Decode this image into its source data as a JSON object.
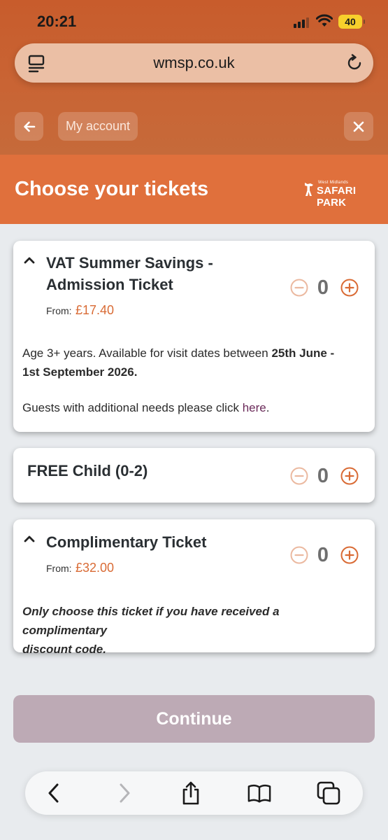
{
  "status_bar": {
    "time": "20:21",
    "battery": "40"
  },
  "browser": {
    "url": "wmsp.co.uk",
    "account_label": "My account"
  },
  "header": {
    "title": "Choose your tickets",
    "brand_small": "West Midlands",
    "brand_name": "SAFARI PARK"
  },
  "tickets": [
    {
      "name_line1": "VAT Summer Savings -",
      "name_line2": "Admission Ticket",
      "from_label": "From:",
      "price": "£17.40",
      "quantity": "0",
      "desc_1a": "Age 3+ years. Available for visit dates between ",
      "desc_1b": "25th June -",
      "desc_2": "1st September 2026.",
      "desc_3a": "Guests with additional needs please click ",
      "desc_3_link": "here",
      "desc_3b": "."
    },
    {
      "name": "FREE Child (0-2)",
      "quantity": "0"
    },
    {
      "name": "Complimentary Ticket",
      "from_label": "From:",
      "price": "£32.00",
      "quantity": "0",
      "desc_1": "Only choose this ticket if you have received a complimentary",
      "desc_2": "discount code."
    }
  ],
  "continue_label": "Continue",
  "colors": {
    "brand_orange": "#e0703c",
    "price_orange": "#d96b35",
    "continue_disabled": "#bdaab5"
  },
  "icons": {
    "url_bar": [
      "page-menu-icon",
      "reload-icon"
    ],
    "nav": [
      "back-arrow-icon",
      "close-icon"
    ],
    "toolbar": [
      "back-icon",
      "forward-icon",
      "share-icon",
      "bookmarks-icon",
      "tabs-icon"
    ]
  }
}
